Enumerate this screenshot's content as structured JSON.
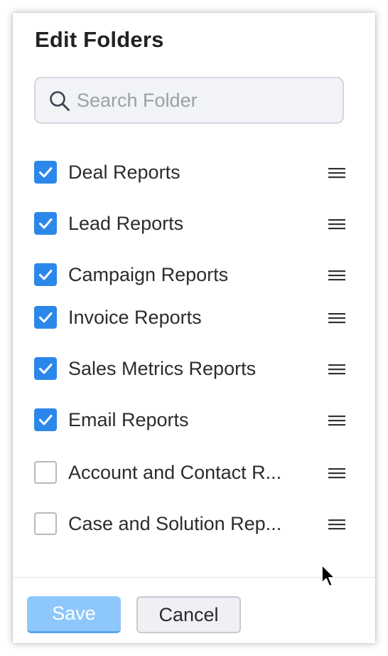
{
  "dialog": {
    "title": "Edit Folders"
  },
  "search": {
    "placeholder": "Search Folder",
    "value": ""
  },
  "folders": [
    {
      "label": "Deal Reports",
      "checked": true
    },
    {
      "label": "Lead Reports",
      "checked": true
    },
    {
      "label": "Campaign Reports",
      "checked": true
    },
    {
      "label": "Invoice Reports",
      "checked": true
    },
    {
      "label": "Sales Metrics Reports",
      "checked": true
    },
    {
      "label": "Email Reports",
      "checked": true
    },
    {
      "label": "Account and Contact R...",
      "checked": false
    },
    {
      "label": "Case and Solution Rep...",
      "checked": false
    }
  ],
  "footer": {
    "save_label": "Save",
    "cancel_label": "Cancel"
  },
  "colors": {
    "accent": "#2b88ea",
    "save_button": "#8ec7fb"
  },
  "icons": {
    "search": "search-icon",
    "checked": "check-icon",
    "drag": "drag-handle-icon",
    "pointer": "mouse-pointer-icon"
  }
}
